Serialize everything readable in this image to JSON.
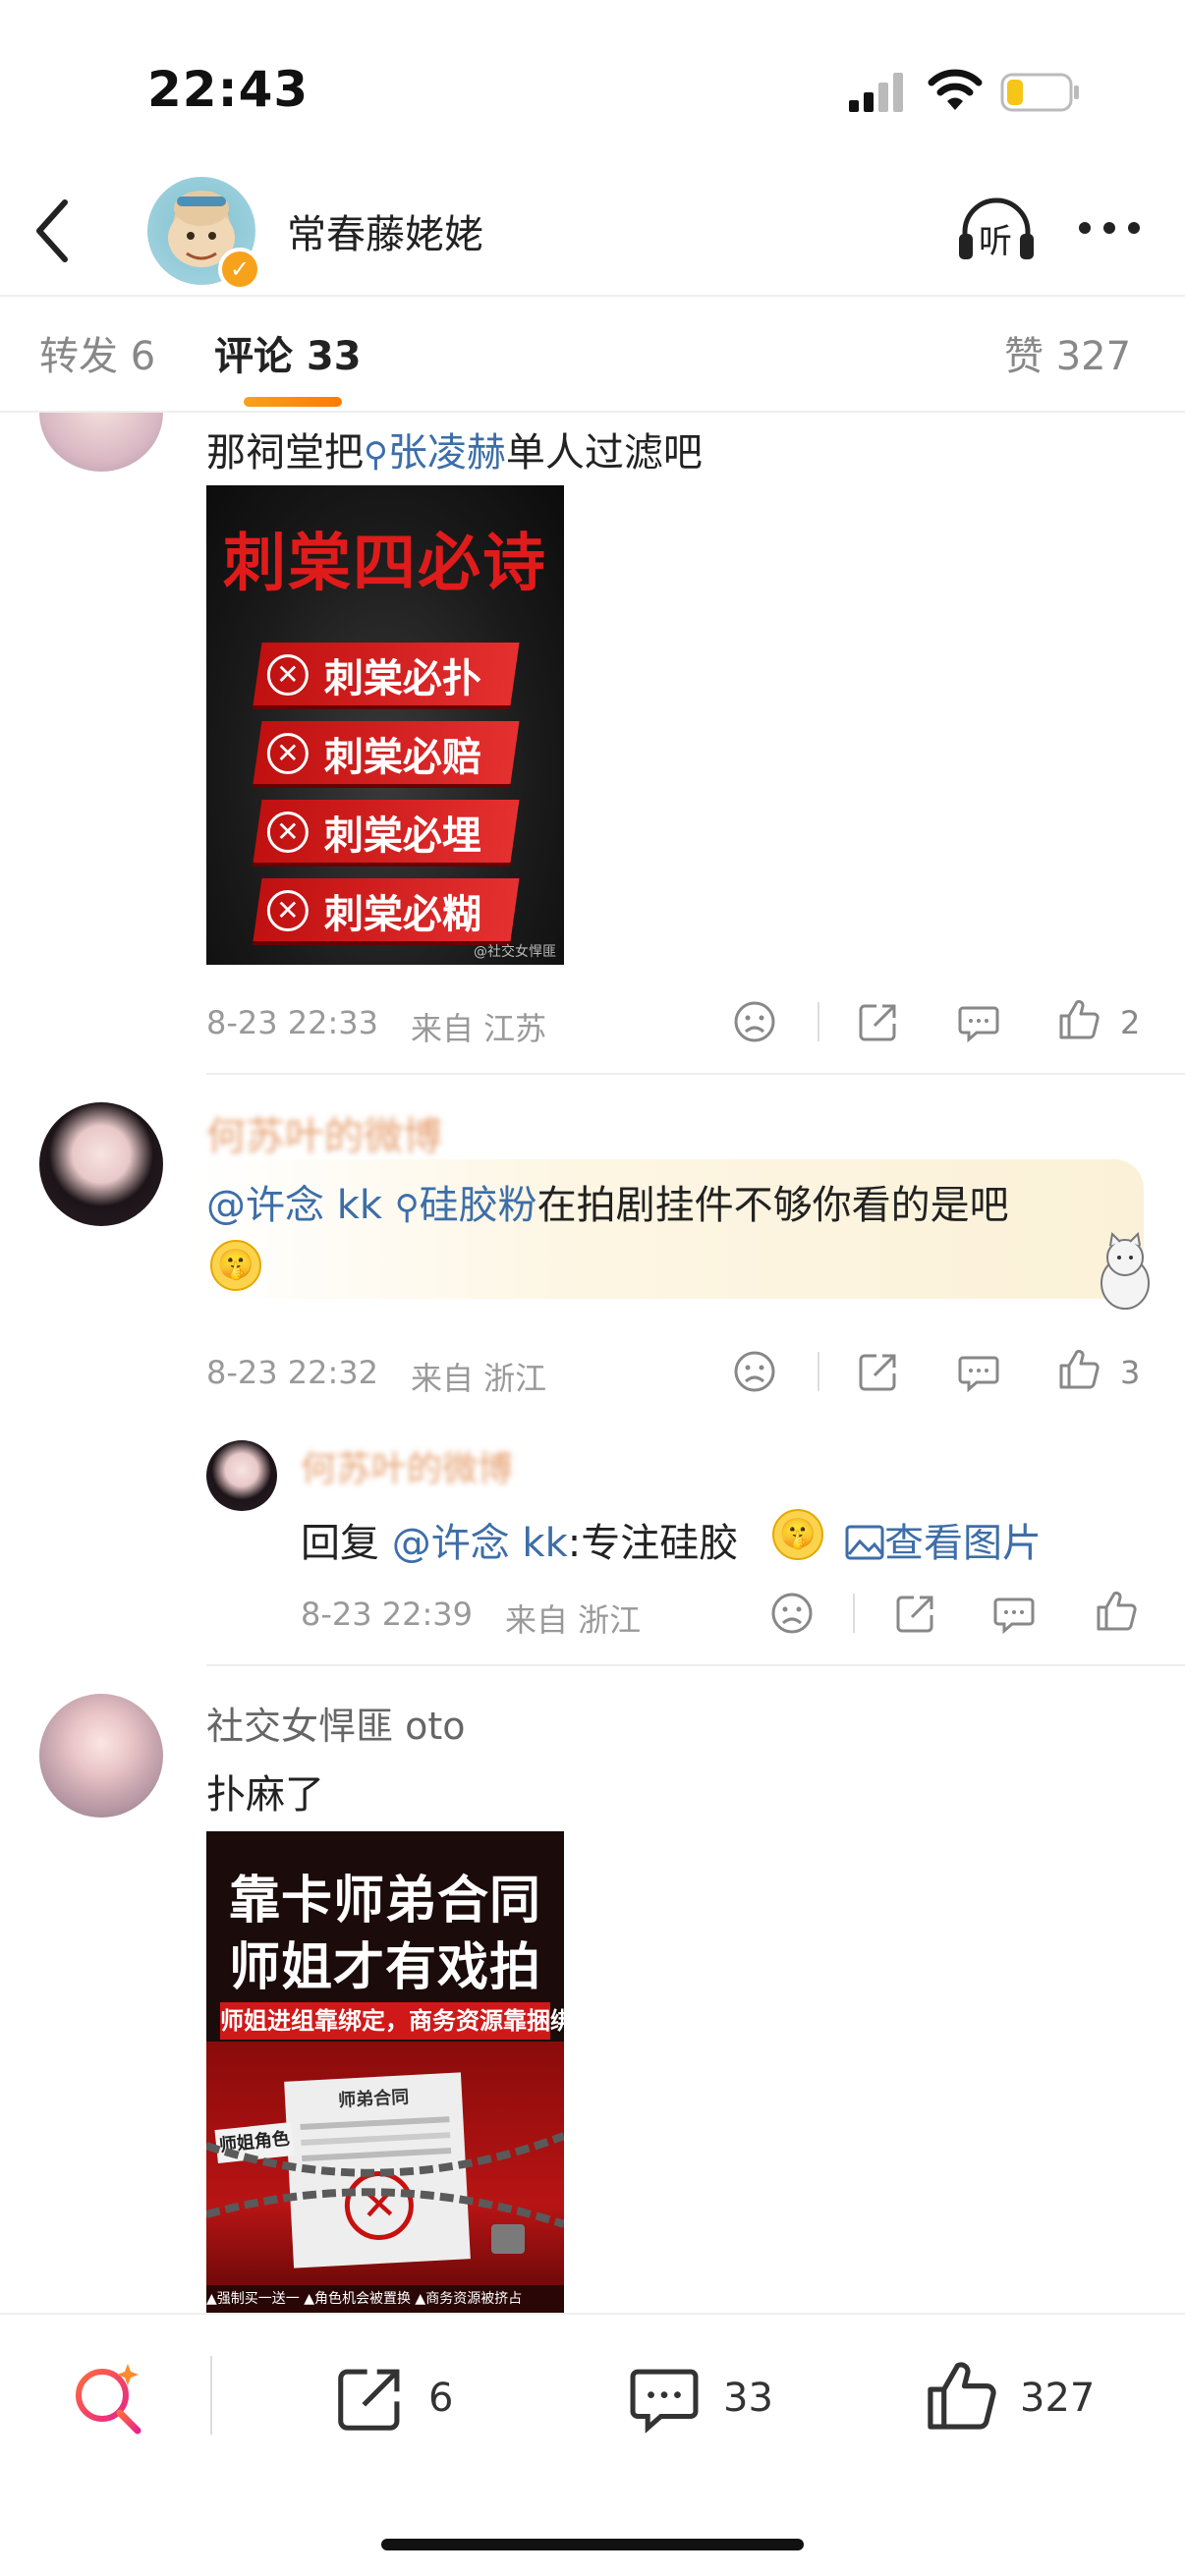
{
  "status_bar": {
    "time": "22:43"
  },
  "header": {
    "username": "常春藤姥姥",
    "listen_label": "听"
  },
  "tabs": {
    "repost": "转发 6",
    "comments": "评论 33",
    "likes": "赞 327"
  },
  "comment1": {
    "text_prefix": "那祠堂把",
    "search_link": "张凌赫",
    "text_suffix": "单人过滤吧",
    "poster": {
      "title": "刺棠四必诗",
      "rows": [
        "刺棠必扑",
        "刺棠必赔",
        "刺棠必埋",
        "刺棠必糊"
      ],
      "credit": "@社交女悍匪"
    },
    "time": "8-23 22:33",
    "source": "来自 江苏",
    "like_count": "2"
  },
  "comment2": {
    "name": "何苏叶的微博",
    "mention": "@许念 kk",
    "search_link": "硅胶粉",
    "text": "在拍剧挂件不够你看的是吧",
    "time": "8-23 22:32",
    "source": "来自 浙江",
    "like_count": "3",
    "reply": {
      "name": "何苏叶的微博",
      "prefix": "回复",
      "mention": "@许念 kk",
      "text": ":专注硅胶",
      "view_image": "查看图片",
      "time": "8-23 22:39",
      "source": "来自 浙江"
    }
  },
  "comment3": {
    "name": "社交女悍匪 oto",
    "text": "扑麻了",
    "poster": {
      "title_line1": "靠卡师弟合同",
      "title_line2": "师姐才有戏拍",
      "subtitle": "师姐进组靠绑定，商务资源靠捆绑",
      "tag": "师姐角色",
      "paper_title": "师弟合同",
      "footer": "▲强制买一送一  ▲角色机会被置换  ▲商务资源被挤占"
    }
  },
  "bottom_bar": {
    "repost_count": "6",
    "comment_count": "33",
    "like_count": "327"
  },
  "colors": {
    "accent": "#f7a21b",
    "link": "#3d6ea8",
    "poster_red": "#e01b1b"
  }
}
